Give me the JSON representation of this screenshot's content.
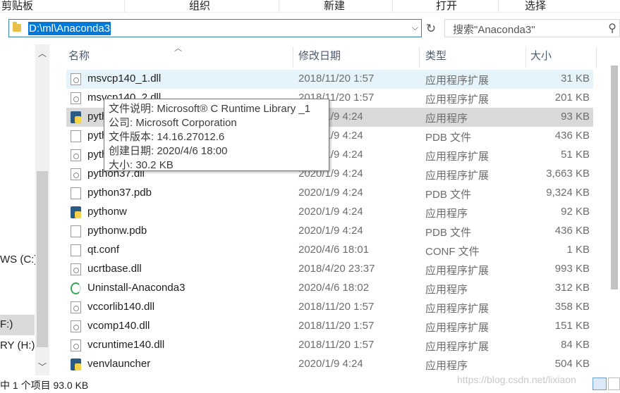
{
  "ribbon": {
    "clipboard": "剪贴板",
    "organize": "组织",
    "new": "新建",
    "open": "打开",
    "select": "选择"
  },
  "address": {
    "path": "D:\\ml\\Anaconda3"
  },
  "search": {
    "placeholder": "搜索\"Anaconda3\""
  },
  "nav": {
    "drive_c": "WS (C:)",
    "drive_f": "F:)",
    "drive_h": "RY (H:)"
  },
  "columns": {
    "name": "名称",
    "date": "修改日期",
    "type": "类型",
    "size": "大小"
  },
  "files": [
    {
      "name": "msvcp140_1.dll",
      "date": "2018/11/20 1:57",
      "type": "应用程序扩展",
      "size": "31 KB",
      "icon": "dll-icon"
    },
    {
      "name": "msvcp140_2.dll",
      "date": "2018/11/20 1:57",
      "type": "应用程序扩展",
      "size": "201 KB",
      "icon": "dll-icon"
    },
    {
      "name": "python",
      "date": "2020/1/9 4:24",
      "type": "应用程序",
      "size": "93 KB",
      "icon": "python-icon"
    },
    {
      "name": "python.pdb",
      "date": "2020/1/9 4:24",
      "type": "PDB 文件",
      "size": "436 KB",
      "icon": "file-icon"
    },
    {
      "name": "python3.dll",
      "date": "2020/1/9 4:24",
      "type": "应用程序扩展",
      "size": "51 KB",
      "icon": "dll-icon"
    },
    {
      "name": "python37.dll",
      "date": "2020/1/9 4:24",
      "type": "应用程序扩展",
      "size": "3,663 KB",
      "icon": "dll-icon"
    },
    {
      "name": "python37.pdb",
      "date": "2020/1/9 4:24",
      "type": "PDB 文件",
      "size": "9,324 KB",
      "icon": "file-icon"
    },
    {
      "name": "pythonw",
      "date": "2020/1/9 4:24",
      "type": "应用程序",
      "size": "92 KB",
      "icon": "python-icon"
    },
    {
      "name": "pythonw.pdb",
      "date": "2020/1/9 4:24",
      "type": "PDB 文件",
      "size": "436 KB",
      "icon": "file-icon"
    },
    {
      "name": "qt.conf",
      "date": "2020/4/6 18:01",
      "type": "CONF 文件",
      "size": "1 KB",
      "icon": "file-icon"
    },
    {
      "name": "ucrtbase.dll",
      "date": "2018/4/20 23:37",
      "type": "应用程序扩展",
      "size": "993 KB",
      "icon": "dll-icon"
    },
    {
      "name": "Uninstall-Anaconda3",
      "date": "2020/4/6 18:02",
      "type": "应用程序",
      "size": "312 KB",
      "icon": "uninstall-icon"
    },
    {
      "name": "vccorlib140.dll",
      "date": "2018/11/20 1:57",
      "type": "应用程序扩展",
      "size": "358 KB",
      "icon": "dll-icon"
    },
    {
      "name": "vcomp140.dll",
      "date": "2018/11/20 1:57",
      "type": "应用程序扩展",
      "size": "151 KB",
      "icon": "dll-icon"
    },
    {
      "name": "vcruntime140.dll",
      "date": "2018/11/20 1:57",
      "type": "应用程序扩展",
      "size": "84 KB",
      "icon": "dll-icon"
    },
    {
      "name": "venvlauncher",
      "date": "2020/1/9 4:24",
      "type": "应用程序",
      "size": "504 KB",
      "icon": "python-icon"
    }
  ],
  "tooltip": {
    "description": "文件说明: Microsoft® C Runtime Library _1",
    "company": "公司: Microsoft Corporation",
    "version": "文件版本: 14.16.27012.6",
    "created": "创建日期: 2020/4/6 18:00",
    "size": "大小: 30.2 KB"
  },
  "status": {
    "selection": "中 1 个项目  93.0 KB",
    "watermark": "https://blog.csdn.net/lixiaon"
  }
}
